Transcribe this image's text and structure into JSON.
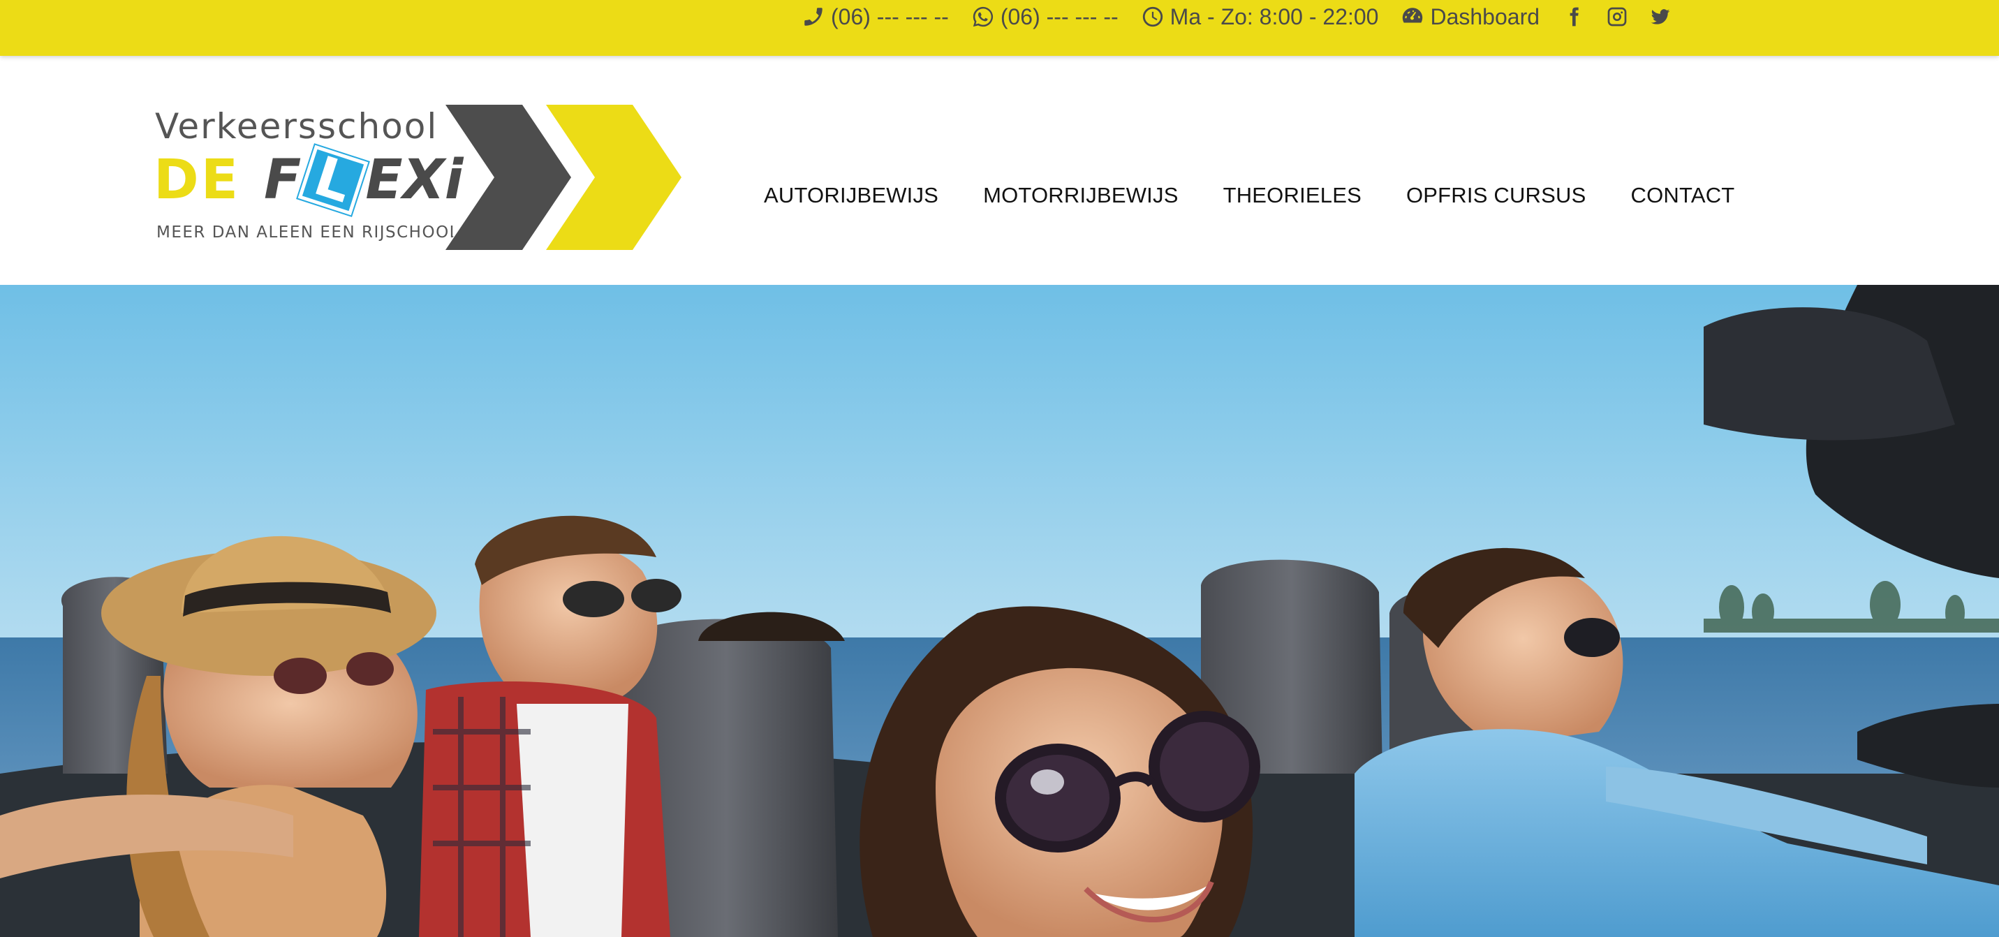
{
  "topbar": {
    "phone": "(06) --- --- --",
    "whatsapp": "(06) --- --- --",
    "hours": "Ma - Zo: 8:00 - 22:00",
    "dashboard": "Dashboard",
    "icons": [
      "phone-icon",
      "whatsapp-icon",
      "clock-icon",
      "dashboard-icon",
      "facebook-icon",
      "instagram-icon",
      "twitter-icon"
    ],
    "background_color": "#ecdc16",
    "text_color": "#4a4a4a"
  },
  "logo": {
    "line1": "Verkeersschool",
    "de": "DE",
    "flexi_f": "F",
    "flexi_l": "L",
    "flexi_rest": "EXi",
    "tagline": "MEER DAN ALEEN EEN RIJSCHOOL",
    "colors": {
      "yellow": "#ecdc16",
      "grey": "#4a4a4a",
      "blue": "#26a9e0"
    }
  },
  "nav": {
    "items": [
      {
        "label": "AUTORIJBEWIJS"
      },
      {
        "label": "MOTORRIJBEWIJS"
      },
      {
        "label": "THEORIELES"
      },
      {
        "label": "OPFRIS CURSUS"
      },
      {
        "label": "CONTACT"
      }
    ]
  },
  "hero": {
    "image": "hero-photo"
  }
}
